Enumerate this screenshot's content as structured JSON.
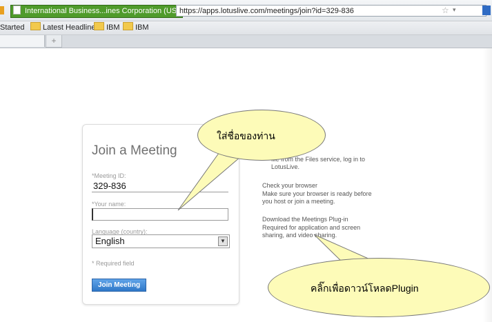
{
  "browser": {
    "site_identity": "International Business...ines Corporation (US)",
    "url": "https://apps.lotuslive.com/meetings/join?id=329-836",
    "bookmarks": [
      {
        "label": "Started"
      },
      {
        "label": "Latest Headlines"
      },
      {
        "label": "IBM"
      },
      {
        "label": "IBM"
      }
    ],
    "new_tab_label": "+"
  },
  "join_form": {
    "title": "Join a Meeting",
    "meeting_id_label": "*Meeting ID:",
    "meeting_id_value": "329-836",
    "name_label": "*Your name:",
    "name_value": "",
    "language_label": "Language (country):",
    "language_value": "English",
    "required_note": "* Required field",
    "join_button": "Join Meeting"
  },
  "side_panel": {
    "files_text": "file from the Files service, log in to LotusLive.",
    "browser_link": "Check your browser",
    "browser_desc": "Make sure your browser is ready before you host or join a meeting.",
    "plugin_link": "Download the Meetings Plug-in",
    "plugin_desc": "Required for application and screen sharing, and video sharing."
  },
  "callouts": {
    "name_hint": "ใส่ชื่อของท่าน",
    "plugin_hint": "คลิ๊กเพื่อดาวน์โหลดPlugin"
  },
  "colors": {
    "callout_fill": "#fdfbb8",
    "button_blue": "#2f78c8",
    "link_blue": "#4a7fc9",
    "identity_green": "#4f9b2b"
  }
}
